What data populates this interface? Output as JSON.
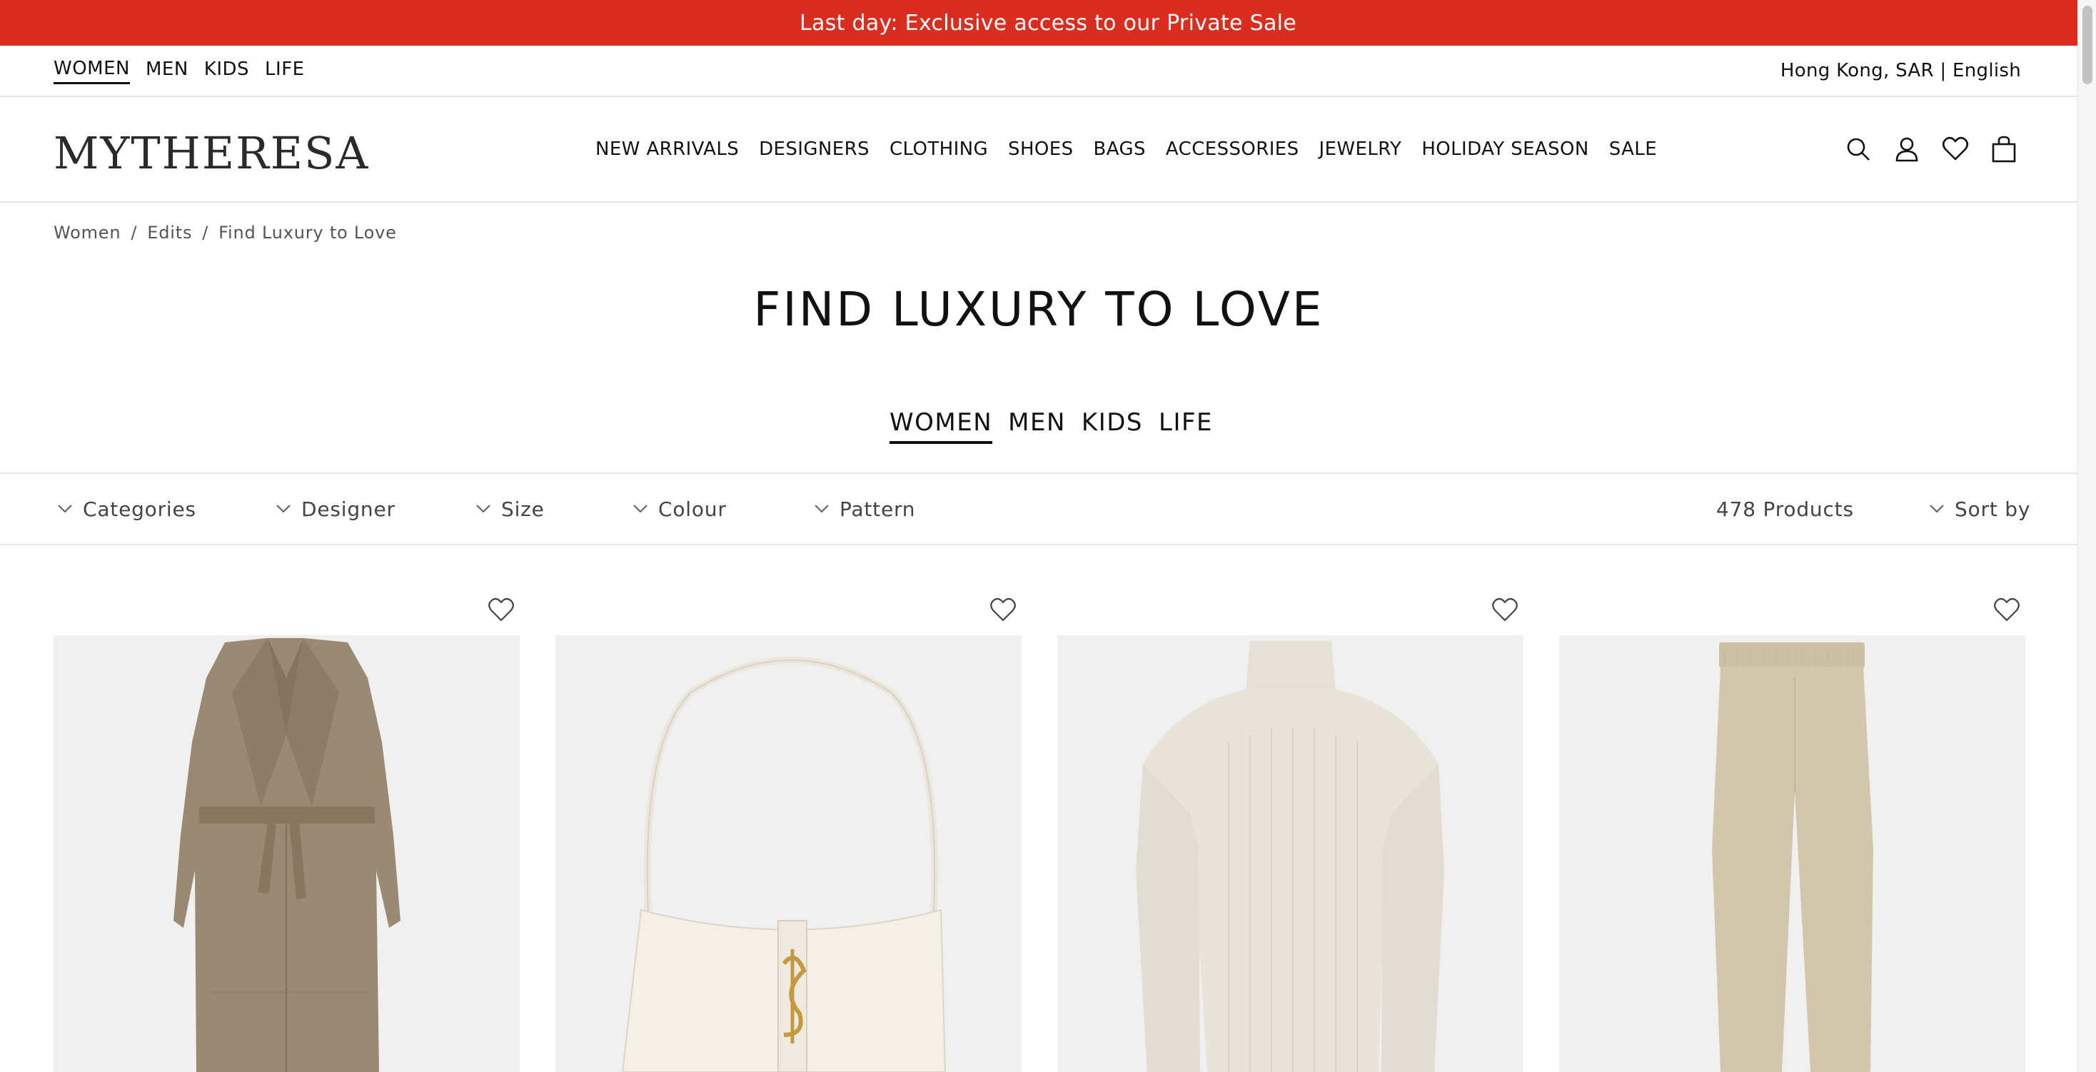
{
  "promo": {
    "text": "Last day: Exclusive access to our Private Sale"
  },
  "top_gender_nav": [
    {
      "label": "WOMEN"
    },
    {
      "label": "MEN"
    },
    {
      "label": "KIDS"
    },
    {
      "label": "LIFE"
    }
  ],
  "locale": {
    "label": "Hong Kong, SAR | English"
  },
  "logo": {
    "text": "MYTHERESA"
  },
  "main_nav": [
    {
      "label": "NEW ARRIVALS"
    },
    {
      "label": "DESIGNERS"
    },
    {
      "label": "CLOTHING"
    },
    {
      "label": "SHOES"
    },
    {
      "label": "BAGS"
    },
    {
      "label": "ACCESSORIES"
    },
    {
      "label": "JEWELRY"
    },
    {
      "label": "HOLIDAY SEASON"
    },
    {
      "label": "SALE"
    }
  ],
  "header_icons": [
    "search-icon",
    "account-icon",
    "wishlist-icon",
    "shopping-bag-icon"
  ],
  "breadcrumb": [
    "Women",
    "/",
    "Edits",
    "/",
    "Find Luxury to Love"
  ],
  "page_title": "FIND LUXURY TO LOVE",
  "gender_tabs": [
    {
      "label": "WOMEN",
      "active": true
    },
    {
      "label": "MEN"
    },
    {
      "label": "KIDS"
    },
    {
      "label": "LIFE"
    }
  ],
  "filters": [
    {
      "label": "Categories"
    },
    {
      "label": "Designer"
    },
    {
      "label": "Size"
    },
    {
      "label": "Colour"
    },
    {
      "label": "Pattern"
    }
  ],
  "product_count": "478 Products",
  "sort": {
    "label": "Sort by"
  },
  "products": [
    {
      "image": "suede-belted-coat"
    },
    {
      "image": "cream-shoulder-bag"
    },
    {
      "image": "ribbed-turtleneck-sweater"
    },
    {
      "image": "knit-sweatpants"
    }
  ],
  "colors": {
    "promo_bg": "#d92d20",
    "text": "#111111",
    "muted": "#555555",
    "tile_bg": "#f0f0f0"
  }
}
